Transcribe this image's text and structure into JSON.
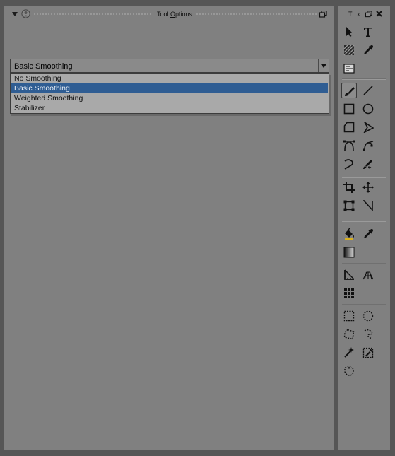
{
  "tool_options_panel": {
    "title_prefix": "Tool ",
    "title_accel": "O",
    "title_rest": "ptions",
    "smoothing": {
      "selected": "Basic Smoothing",
      "options": [
        "No Smoothing",
        "Basic Smoothing",
        "Weighted Smoothing",
        "Stabilizer"
      ],
      "highlighted_index": 1
    }
  },
  "toolbox_panel": {
    "title": "T...x"
  },
  "icons": {
    "collapse": "triangle-down-icon",
    "panel_menu": "circle-menu-icon",
    "float": "float-window-icon",
    "close": "close-icon"
  },
  "colors": {
    "panel_bg": "#808080",
    "frame_bg": "#565656",
    "selection": "#2f5d93"
  }
}
